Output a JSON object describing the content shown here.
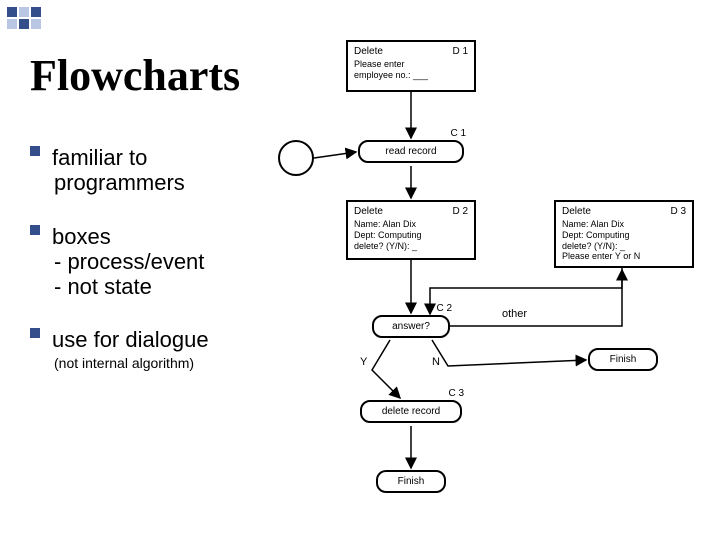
{
  "title": "Flowcharts",
  "bullets": {
    "b1_l1": "familiar to",
    "b1_l2": "programmers",
    "b2_l1": "boxes",
    "b2_l2": "- process/event",
    "b2_l3": "- not state",
    "b3_l1": "use for dialogue",
    "b3_note": "(not internal algorithm)"
  },
  "nodes": {
    "d1_label": "Delete",
    "d1_id": "D 1",
    "d1_body": "Please enter\nemployee no.: ___",
    "c1_label": "read record",
    "c1_id": "C 1",
    "d2_label": "Delete",
    "d2_id": "D 2",
    "d2_body": "Name: Alan Dix\nDept: Computing\ndelete? (Y/N): _",
    "d3_label": "Delete",
    "d3_id": "D 3",
    "d3_body": "Name: Alan Dix\nDept: Computing\ndelete? (Y/N): _\nPlease enter Y or N",
    "c2_label": "answer?",
    "c2_id": "C 2",
    "c3_label": "delete record",
    "c3_id": "C 3",
    "finish1": "Finish",
    "finish2": "Finish"
  },
  "edges": {
    "other": "other",
    "y": "Y",
    "n": "N"
  },
  "colors": {
    "bullet": "#334e8b"
  }
}
